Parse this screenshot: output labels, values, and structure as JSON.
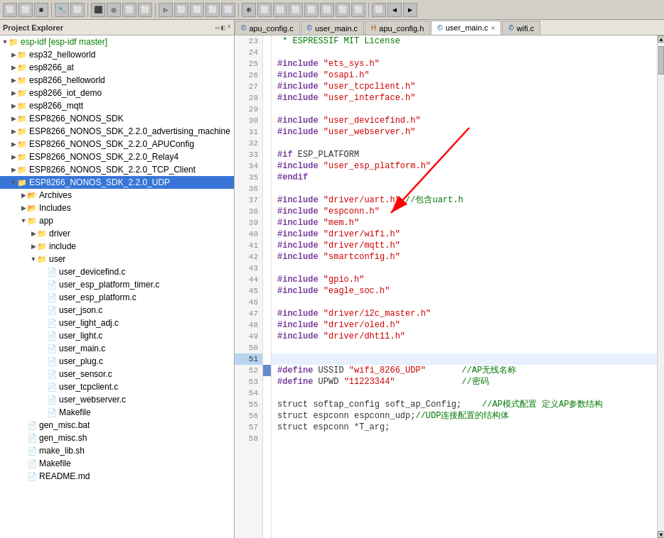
{
  "toolbar": {
    "icons": [
      "⬜",
      "⬜",
      "⬜",
      "⬜",
      "⬜",
      "⬜",
      "⬜",
      "⬜",
      "⬜",
      "⬜",
      "⬜",
      "⬜",
      "⬜",
      "⬜",
      "⬜",
      "⬜",
      "⬜",
      "⬜",
      "⬜",
      "⬜",
      "⬜",
      "⬜",
      "⬜",
      "⬜",
      "⬜",
      "⬜",
      "⬜",
      "⬜",
      "⬜",
      "⬜",
      "⬜",
      "⬜",
      "⬜",
      "⬜",
      "⬜",
      "⬜",
      "⬜",
      "⬜"
    ]
  },
  "leftPanel": {
    "title": "Project Explorer",
    "items": [
      {
        "id": "esp-idf",
        "level": 0,
        "label": "esp-idf [esp-idf master]",
        "type": "folder",
        "expanded": true,
        "color": "green"
      },
      {
        "id": "esp32_helloworld",
        "level": 1,
        "label": "esp32_helloworld",
        "type": "folder",
        "expanded": false
      },
      {
        "id": "esp8266_at",
        "level": 1,
        "label": "esp8266_at",
        "type": "folder",
        "expanded": false
      },
      {
        "id": "esp8266_helloworld",
        "level": 1,
        "label": "esp8266_helloworld",
        "type": "folder",
        "expanded": false
      },
      {
        "id": "esp8266_iot_demo",
        "level": 1,
        "label": "esp8266_iot_demo",
        "type": "folder",
        "expanded": false
      },
      {
        "id": "esp8266_mqtt",
        "level": 1,
        "label": "esp8266_mqtt",
        "type": "folder",
        "expanded": false
      },
      {
        "id": "ESP8266_NONOS_SDK",
        "level": 1,
        "label": "ESP8266_NONOS_SDK",
        "type": "folder",
        "expanded": false
      },
      {
        "id": "ESP8266_NONOS_SDK_2.2.0_advertising_machine",
        "level": 1,
        "label": "ESP8266_NONOS_SDK_2.2.0_advertising_machine",
        "type": "folder",
        "expanded": false
      },
      {
        "id": "ESP8266_NONOS_SDK_2.2.0_APUConfig",
        "level": 1,
        "label": "ESP8266_NONOS_SDK_2.2.0_APUConfig",
        "type": "folder",
        "expanded": false
      },
      {
        "id": "ESP8266_NONOS_SDK_2.2.0_Relay4",
        "level": 1,
        "label": "ESP8266_NONOS_SDK_2.2.0_Relay4",
        "type": "folder",
        "expanded": false
      },
      {
        "id": "ESP8266_NONOS_SDK_2.2.0_TCP_Client",
        "level": 1,
        "label": "ESP8266_NONOS_SDK_2.2.0_TCP_Client",
        "type": "folder",
        "expanded": false
      },
      {
        "id": "ESP8266_NONOS_SDK_2.2.0_UDP",
        "level": 1,
        "label": "ESP8266_NONOS_SDK_2.2.0_UDP",
        "type": "folder",
        "expanded": true,
        "selected": true
      },
      {
        "id": "Archives",
        "level": 2,
        "label": "Archives",
        "type": "folder-plain",
        "expanded": false
      },
      {
        "id": "Includes",
        "level": 2,
        "label": "Includes",
        "type": "folder-plain",
        "expanded": false
      },
      {
        "id": "app",
        "level": 2,
        "label": "app",
        "type": "folder",
        "expanded": true
      },
      {
        "id": "driver",
        "level": 3,
        "label": "driver",
        "type": "folder",
        "expanded": false
      },
      {
        "id": "include",
        "level": 3,
        "label": "include",
        "type": "folder",
        "expanded": false
      },
      {
        "id": "user",
        "level": 3,
        "label": "user",
        "type": "folder",
        "expanded": true
      },
      {
        "id": "user_devicefind.c",
        "level": 4,
        "label": "user_devicefind.c",
        "type": "file"
      },
      {
        "id": "user_esp_platform_timer.c",
        "level": 4,
        "label": "user_esp_platform_timer.c",
        "type": "file"
      },
      {
        "id": "user_esp_platform.c",
        "level": 4,
        "label": "user_esp_platform.c",
        "type": "file"
      },
      {
        "id": "user_json.c",
        "level": 4,
        "label": "user_json.c",
        "type": "file"
      },
      {
        "id": "user_light_adj.c",
        "level": 4,
        "label": "user_light_adj.c",
        "type": "file"
      },
      {
        "id": "user_light.c",
        "level": 4,
        "label": "user_light.c",
        "type": "file"
      },
      {
        "id": "user_main.c",
        "level": 4,
        "label": "user_main.c",
        "type": "file"
      },
      {
        "id": "user_plug.c",
        "level": 4,
        "label": "user_plug.c",
        "type": "file"
      },
      {
        "id": "user_sensor.c",
        "level": 4,
        "label": "user_sensor.c",
        "type": "file"
      },
      {
        "id": "user_tcpclient.c",
        "level": 4,
        "label": "user_tcpclient.c",
        "type": "file"
      },
      {
        "id": "user_webserver.c",
        "level": 4,
        "label": "user_webserver.c",
        "type": "file"
      },
      {
        "id": "Makefile-app",
        "level": 4,
        "label": "Makefile",
        "type": "makefile"
      },
      {
        "id": "gen_misc.bat",
        "level": 2,
        "label": "gen_misc.bat",
        "type": "file"
      },
      {
        "id": "gen_misc.sh",
        "level": 2,
        "label": "gen_misc.sh",
        "type": "file"
      },
      {
        "id": "make_lib.sh",
        "level": 2,
        "label": "make_lib.sh",
        "type": "file"
      },
      {
        "id": "Makefile-root",
        "level": 2,
        "label": "Makefile",
        "type": "makefile"
      },
      {
        "id": "README.md",
        "level": 2,
        "label": "README.md",
        "type": "file"
      }
    ]
  },
  "tabs": [
    {
      "id": "apu_config_c",
      "label": "apu_config.c",
      "active": false,
      "icon": "c-file"
    },
    {
      "id": "user_main_c1",
      "label": "user_main.c",
      "active": false,
      "icon": "c-file"
    },
    {
      "id": "apu_config_h",
      "label": "apu_config.h",
      "active": false,
      "icon": "h-file"
    },
    {
      "id": "user_main_c2",
      "label": "user_main.c",
      "active": true,
      "icon": "c-file",
      "closeable": true
    },
    {
      "id": "wifi_c",
      "label": "wifi.c",
      "active": false,
      "icon": "c-file"
    }
  ],
  "editor": {
    "filename": "user_main.c",
    "lines": [
      {
        "num": 23,
        "content": " * · ESPRESSIF · MIT · License·",
        "type": "comment"
      },
      {
        "num": 24,
        "content": " ¶",
        "type": "plain"
      },
      {
        "num": 25,
        "content": "#include \"ets_sys.h\"¶",
        "type": "include"
      },
      {
        "num": 26,
        "content": "#include \"osapi.h\"¶",
        "type": "include"
      },
      {
        "num": 27,
        "content": "#include \"user_tcpclient.h\"¶",
        "type": "include"
      },
      {
        "num": 28,
        "content": "#include \"user_interface.h\"¶",
        "type": "include"
      },
      {
        "num": 29,
        "content": " ¶",
        "type": "plain"
      },
      {
        "num": 30,
        "content": "#include \"user_devicefind.h\"¶",
        "type": "include"
      },
      {
        "num": 31,
        "content": "#include \"user_webserver.h\"¶",
        "type": "include"
      },
      {
        "num": 32,
        "content": " ¶",
        "type": "plain"
      },
      {
        "num": 33,
        "content": "#if ESP_PLATFORM¶",
        "type": "directive"
      },
      {
        "num": 34,
        "content": "#include \"user_esp_platform.h\"¶",
        "type": "include"
      },
      {
        "num": 35,
        "content": "#endif¶",
        "type": "directive"
      },
      {
        "num": 36,
        "content": " ¶",
        "type": "plain"
      },
      {
        "num": 37,
        "content": "#include \"driver/uart.h\" //包含uart.h",
        "type": "include-comment"
      },
      {
        "num": 38,
        "content": "#include \"espconn.h\"¶",
        "type": "include"
      },
      {
        "num": 39,
        "content": "#include \"mem.h\"¶",
        "type": "include"
      },
      {
        "num": 40,
        "content": "#include \"driver/wifi.h\"¶",
        "type": "include"
      },
      {
        "num": 41,
        "content": "#include \"driver/mqtt.h\"¶",
        "type": "include"
      },
      {
        "num": 42,
        "content": "#include \"smartconfig.h\"¶",
        "type": "include"
      },
      {
        "num": 43,
        "content": " ¶",
        "type": "plain"
      },
      {
        "num": 44,
        "content": "#include \"gpio.h\"¶",
        "type": "include"
      },
      {
        "num": 45,
        "content": "#include \"eagle_soc.h\"¶",
        "type": "include"
      },
      {
        "num": 46,
        "content": " ¶",
        "type": "plain"
      },
      {
        "num": 47,
        "content": "#include \"driver/i2c_master.h\"¶",
        "type": "include"
      },
      {
        "num": 48,
        "content": "#include \"driver/oled.h\"¶",
        "type": "include"
      },
      {
        "num": 49,
        "content": "#include \"driver/dht11.h\"¶",
        "type": "include"
      },
      {
        "num": 50,
        "content": " ¶",
        "type": "plain"
      },
      {
        "num": 51,
        "content": " ¶",
        "type": "plain",
        "highlighted": true
      },
      {
        "num": 52,
        "content": "#define USSID \"wifi_8266_UDP\" ···    //AP无线名称",
        "type": "define-comment"
      },
      {
        "num": 53,
        "content": "#define UPWD \"11223344\" ·····>  ··>     //密码",
        "type": "define-comment"
      },
      {
        "num": 54,
        "content": " ¶",
        "type": "plain"
      },
      {
        "num": 55,
        "content": "struct softap_config soft_ap_Config;    //AP模式配置 定义AP参数结构",
        "type": "code-comment"
      },
      {
        "num": 56,
        "content": "struct espconn espconn_udp;//UDP连接配置的结构体",
        "type": "code-comment"
      },
      {
        "num": 57,
        "content": "struct espconn *T_arg;¶",
        "type": "code"
      },
      {
        "num": 58,
        "content": " ¶",
        "type": "plain"
      }
    ]
  }
}
